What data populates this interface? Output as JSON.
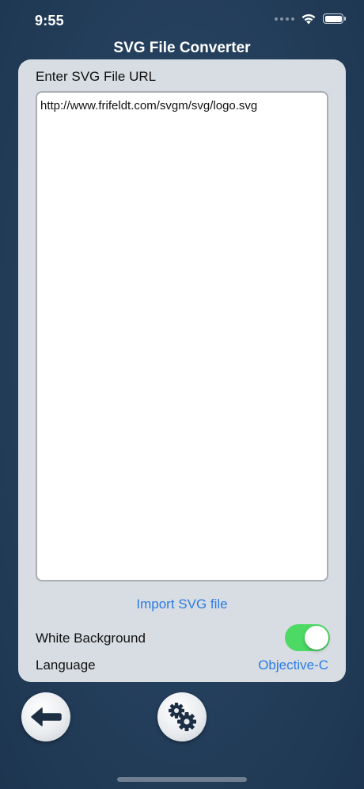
{
  "status_bar": {
    "time": "9:55",
    "icons": [
      "signal-dots-icon",
      "wifi-icon",
      "battery-icon"
    ]
  },
  "navigation": {
    "title": "SVG File Converter"
  },
  "form": {
    "url_label": "Enter SVG File URL",
    "url_value": "http://www.frifeldt.com/svgm/svg/logo.svg",
    "import_label": "Import SVG file",
    "white_background_label": "White Background",
    "white_background_on": true,
    "language_label": "Language",
    "language_value": "Objective-C"
  },
  "toolbar": {
    "back_icon": "arrow-left-icon",
    "settings_icon": "gears-icon"
  },
  "colors": {
    "background": "#243f5c",
    "card": "#d8dde3",
    "link": "#2a7be4",
    "toggle_on": "#4cd964"
  }
}
